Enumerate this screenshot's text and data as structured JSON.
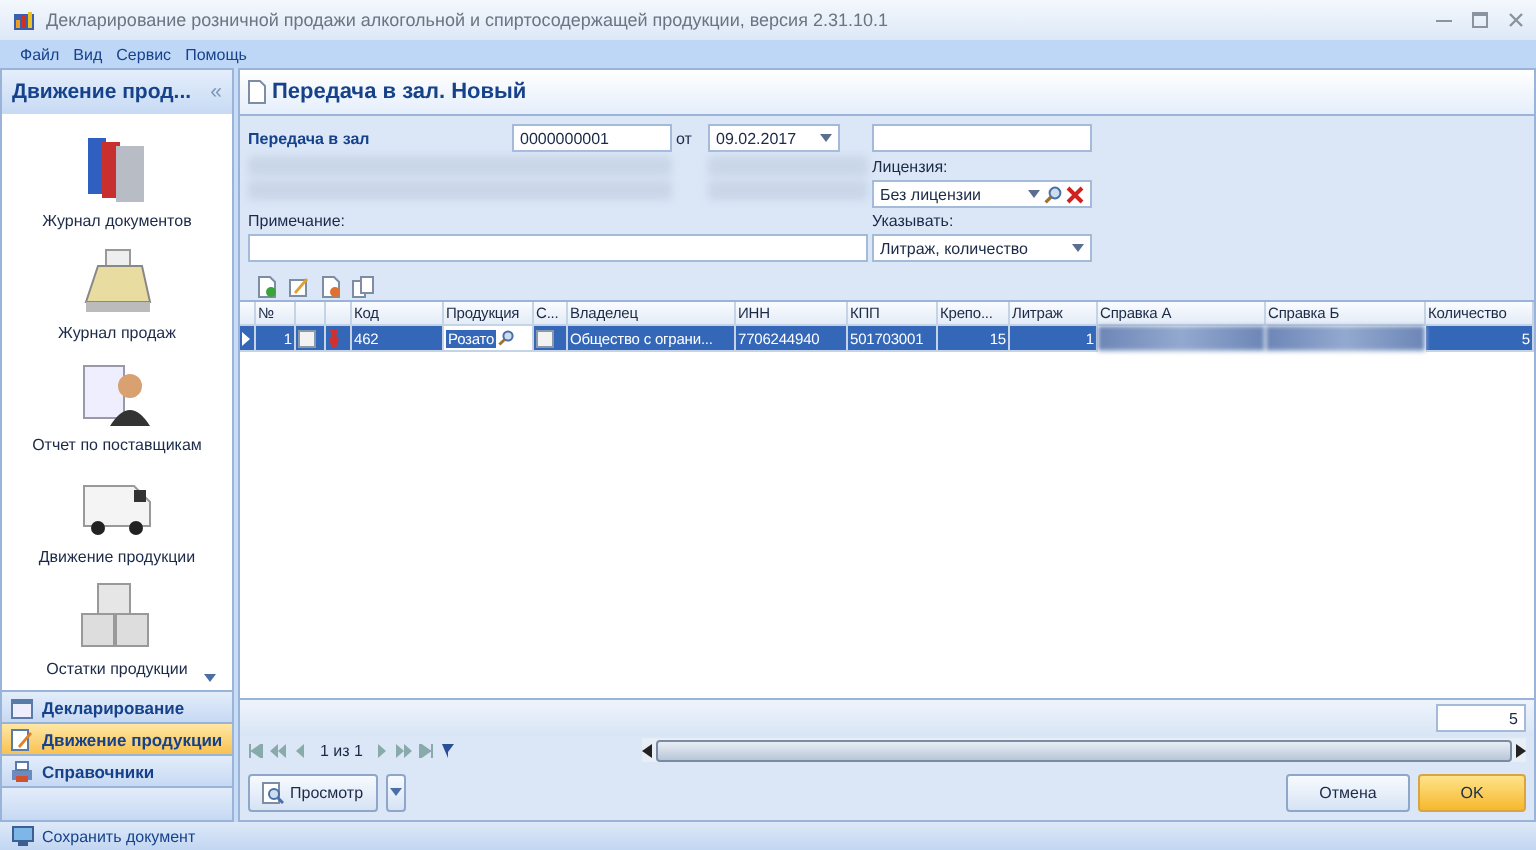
{
  "window": {
    "title": "Декларирование розничной продажи алкогольной и спиртосодержащей продукции, версия 2.31.10.1"
  },
  "menu": [
    "Файл",
    "Вид",
    "Сервис",
    "Помощь"
  ],
  "sidebar": {
    "title": "Движение прод...",
    "collapse": "«",
    "items": [
      {
        "label": "Журнал документов",
        "kind": "books"
      },
      {
        "label": "Журнал продаж",
        "kind": "register"
      },
      {
        "label": "Отчет по поставщикам",
        "kind": "person"
      },
      {
        "label": "Движение продукции",
        "kind": "van"
      },
      {
        "label": "Остатки продукции",
        "kind": "boxes"
      }
    ],
    "sections": [
      {
        "label": "Декларирование",
        "kind": "calendar",
        "selected": false
      },
      {
        "label": "Движение продукции",
        "kind": "edit",
        "selected": true
      },
      {
        "label": "Справочники",
        "kind": "printer",
        "selected": false
      }
    ]
  },
  "document": {
    "title": "Передача в зал. Новый",
    "doc_label": "Передача в зал",
    "number": "0000000001",
    "date_prefix": "от",
    "date": "09.02.2017",
    "license_label": "Лицензия:",
    "license": "Без лицензии",
    "note_label": "Примечание:",
    "show_label": "Указывать:",
    "show": "Литраж, количество"
  },
  "table": {
    "columns": [
      "№",
      "Код",
      "Продукция",
      "С...",
      "Владелец",
      "ИНН",
      "КПП",
      "Крепо...",
      "Литраж",
      "Справка А",
      "Справка Б",
      "Количество"
    ],
    "rows": [
      {
        "number": "1",
        "checked": false,
        "code": "462",
        "product": "Розато",
        "c_checked": false,
        "owner": "Общество с ограни...",
        "inn": "7706244940",
        "kpp": "501703001",
        "strength": "15",
        "volume": "1",
        "quantity": "5",
        "selected": true
      }
    ],
    "total": "5"
  },
  "pager": "1 из 1",
  "buttons": {
    "preview": "Просмотр",
    "cancel": "Отмена",
    "ok": "OK"
  },
  "status_bar": "Сохранить документ"
}
